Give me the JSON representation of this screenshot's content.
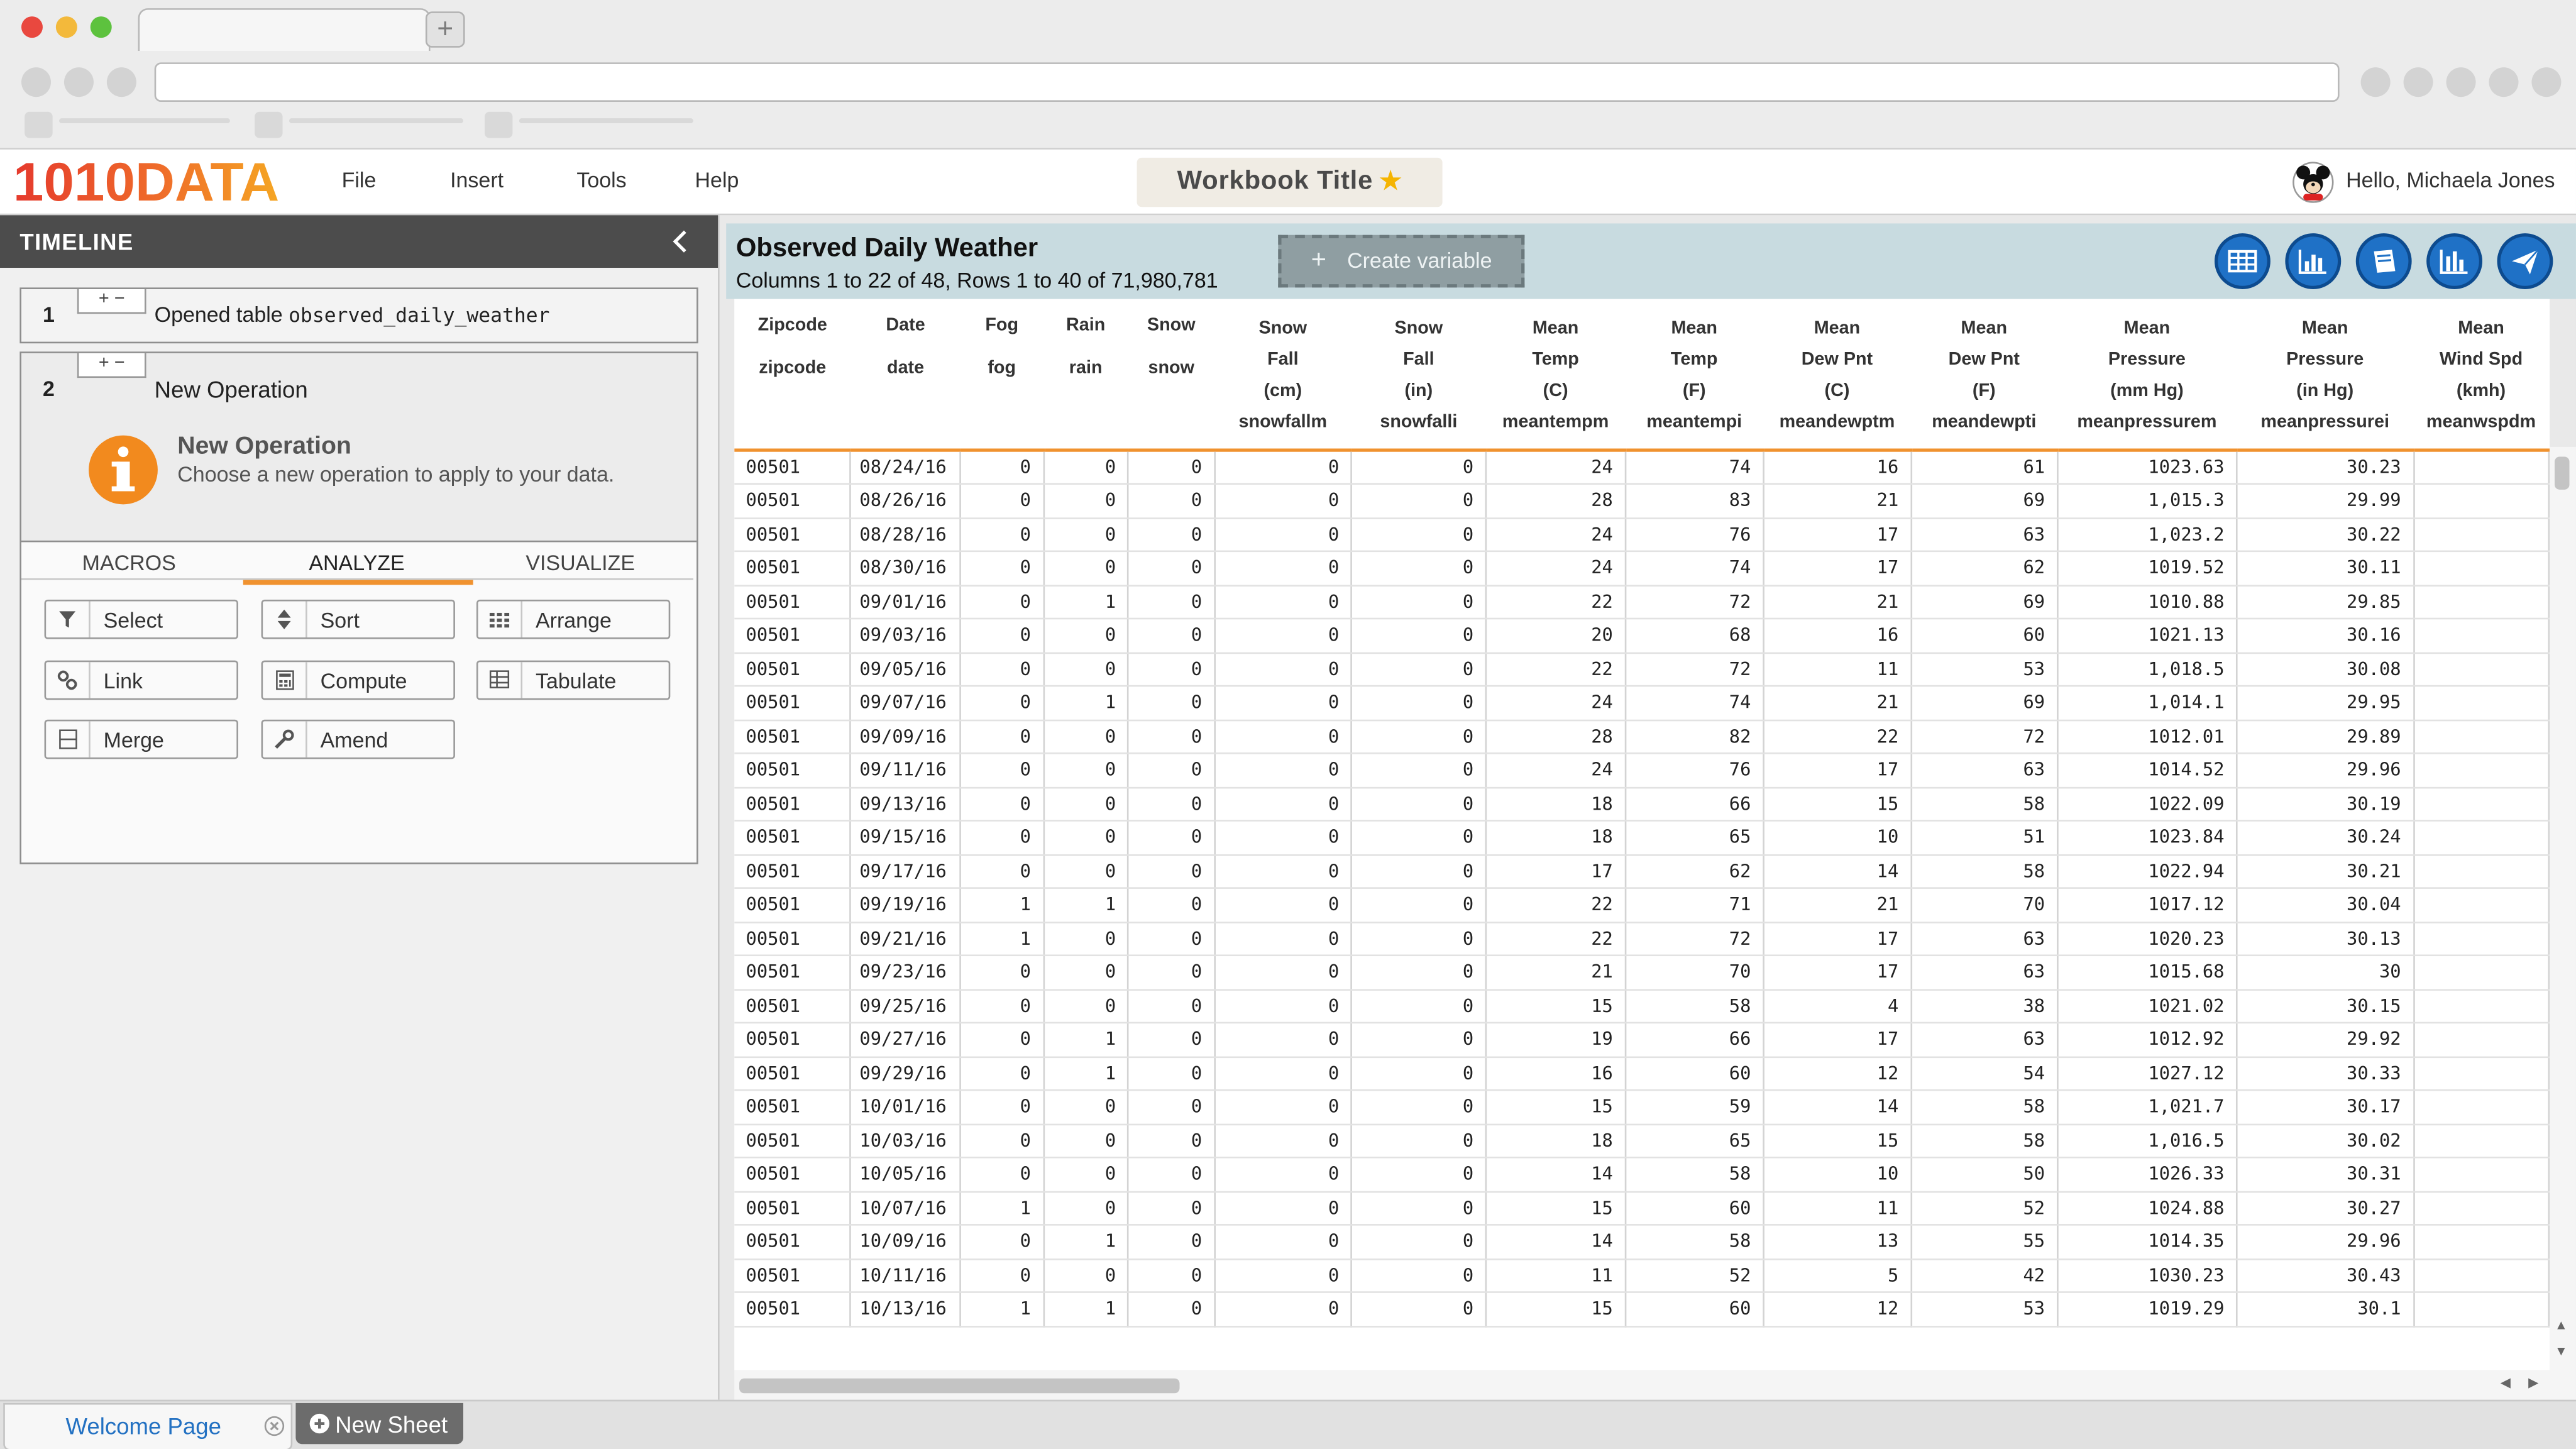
{
  "browser": {
    "traffic_lights": [
      "#e9483f",
      "#f3b93b",
      "#5dc23e"
    ],
    "new_tab_icon": "plus-icon"
  },
  "app": {
    "logo": "1010DATA",
    "logo_colors": [
      "#e53a2d",
      "#f5a623"
    ],
    "menu": [
      "File",
      "Insert",
      "Tools",
      "Help"
    ],
    "workbook_title": "Workbook Title",
    "star_icon": "star-icon",
    "user_greeting": "Hello, Michaela Jones",
    "avatar_icon": "mickey-avatar-icon"
  },
  "sidebar": {
    "title": "TIMELINE",
    "collapse_icon": "chevron-left-icon",
    "steps": [
      {
        "num": "1",
        "label": "Opened table ",
        "table": "observed_daily_weather"
      },
      {
        "num": "2",
        "label": "New Operation"
      }
    ],
    "info": {
      "icon": "info-icon",
      "title": "New Operation",
      "text": "Choose a new operation to apply to your data."
    },
    "tabs": [
      "MACROS",
      "ANALYZE",
      "VISUALIZE"
    ],
    "active_tab": "ANALYZE",
    "operations": [
      {
        "label": "Select",
        "icon": "filter-icon"
      },
      {
        "label": "Sort",
        "icon": "sort-icon"
      },
      {
        "label": "Arrange",
        "icon": "arrange-grid-icon"
      },
      {
        "label": "Link",
        "icon": "link-icon"
      },
      {
        "label": "Compute",
        "icon": "calculator-icon"
      },
      {
        "label": "Tabulate",
        "icon": "table-icon"
      },
      {
        "label": "Merge",
        "icon": "merge-icon"
      },
      {
        "label": "Amend",
        "icon": "wrench-icon"
      }
    ]
  },
  "main": {
    "title": "Observed Daily Weather",
    "subtitle": "Columns 1 to 22 of 48, Rows 1 to 40 of 71,980,781",
    "create_variable": "Create variable",
    "toolbar_icons": [
      "grid-view-icon",
      "bar-chart-icon",
      "book-icon",
      "histogram-icon",
      "send-icon"
    ],
    "accent": "#1f71c6",
    "header_underline": "#f0922f",
    "columns": [
      {
        "lines": [
          "Zipcode",
          "",
          "",
          "zipcode"
        ],
        "align": "l",
        "w": 74
      },
      {
        "lines": [
          "Date",
          "",
          "",
          "date"
        ],
        "align": "c",
        "w": 67
      },
      {
        "lines": [
          "Fog",
          "",
          "",
          "fog"
        ],
        "align": "r",
        "w": 54
      },
      {
        "lines": [
          "Rain",
          "",
          "",
          "rain"
        ],
        "align": "r",
        "w": 55
      },
      {
        "lines": [
          "Snow",
          "",
          "",
          "snow"
        ],
        "align": "r",
        "w": 55
      },
      {
        "lines": [
          "Snow",
          "Fall",
          "(cm)",
          "snowfallm"
        ],
        "align": "r",
        "w": 87
      },
      {
        "lines": [
          "Snow",
          "Fall",
          "(in)",
          "snowfalli"
        ],
        "align": "r",
        "w": 86
      },
      {
        "lines": [
          "Mean",
          "Temp",
          "(C)",
          "meantempm"
        ],
        "align": "r",
        "w": 87
      },
      {
        "lines": [
          "Mean",
          "Temp",
          "(F)",
          "meantempi"
        ],
        "align": "r",
        "w": 87
      },
      {
        "lines": [
          "Mean",
          "Dew Pnt",
          "(C)",
          "meandewptm"
        ],
        "align": "r",
        "w": 92
      },
      {
        "lines": [
          "Mean",
          "Dew Pnt",
          "(F)",
          "meandewpti"
        ],
        "align": "r",
        "w": 92
      },
      {
        "lines": [
          "Mean",
          "Pressure",
          "(mm Hg)",
          "meanpressurem"
        ],
        "align": "r",
        "w": 112
      },
      {
        "lines": [
          "Mean",
          "Pressure",
          "(in Hg)",
          "meanpressurei"
        ],
        "align": "r",
        "w": 111
      },
      {
        "lines": [
          "Mean",
          "Wind Spd",
          "(kmh)",
          "meanwspdm"
        ],
        "align": "r",
        "w": 84
      }
    ],
    "rows": [
      [
        "00501",
        "08/24/16",
        "0",
        "0",
        "0",
        "0",
        "0",
        "24",
        "74",
        "16",
        "61",
        "1023.63",
        "30.23",
        ""
      ],
      [
        "00501",
        "08/26/16",
        "0",
        "0",
        "0",
        "0",
        "0",
        "28",
        "83",
        "21",
        "69",
        "1,015.3",
        "29.99",
        ""
      ],
      [
        "00501",
        "08/28/16",
        "0",
        "0",
        "0",
        "0",
        "0",
        "24",
        "76",
        "17",
        "63",
        "1,023.2",
        "30.22",
        ""
      ],
      [
        "00501",
        "08/30/16",
        "0",
        "0",
        "0",
        "0",
        "0",
        "24",
        "74",
        "17",
        "62",
        "1019.52",
        "30.11",
        ""
      ],
      [
        "00501",
        "09/01/16",
        "0",
        "1",
        "0",
        "0",
        "0",
        "22",
        "72",
        "21",
        "69",
        "1010.88",
        "29.85",
        ""
      ],
      [
        "00501",
        "09/03/16",
        "0",
        "0",
        "0",
        "0",
        "0",
        "20",
        "68",
        "16",
        "60",
        "1021.13",
        "30.16",
        ""
      ],
      [
        "00501",
        "09/05/16",
        "0",
        "0",
        "0",
        "0",
        "0",
        "22",
        "72",
        "11",
        "53",
        "1,018.5",
        "30.08",
        ""
      ],
      [
        "00501",
        "09/07/16",
        "0",
        "1",
        "0",
        "0",
        "0",
        "24",
        "74",
        "21",
        "69",
        "1,014.1",
        "29.95",
        ""
      ],
      [
        "00501",
        "09/09/16",
        "0",
        "0",
        "0",
        "0",
        "0",
        "28",
        "82",
        "22",
        "72",
        "1012.01",
        "29.89",
        ""
      ],
      [
        "00501",
        "09/11/16",
        "0",
        "0",
        "0",
        "0",
        "0",
        "24",
        "76",
        "17",
        "63",
        "1014.52",
        "29.96",
        ""
      ],
      [
        "00501",
        "09/13/16",
        "0",
        "0",
        "0",
        "0",
        "0",
        "18",
        "66",
        "15",
        "58",
        "1022.09",
        "30.19",
        ""
      ],
      [
        "00501",
        "09/15/16",
        "0",
        "0",
        "0",
        "0",
        "0",
        "18",
        "65",
        "10",
        "51",
        "1023.84",
        "30.24",
        ""
      ],
      [
        "00501",
        "09/17/16",
        "0",
        "0",
        "0",
        "0",
        "0",
        "17",
        "62",
        "14",
        "58",
        "1022.94",
        "30.21",
        ""
      ],
      [
        "00501",
        "09/19/16",
        "1",
        "1",
        "0",
        "0",
        "0",
        "22",
        "71",
        "21",
        "70",
        "1017.12",
        "30.04",
        ""
      ],
      [
        "00501",
        "09/21/16",
        "1",
        "0",
        "0",
        "0",
        "0",
        "22",
        "72",
        "17",
        "63",
        "1020.23",
        "30.13",
        ""
      ],
      [
        "00501",
        "09/23/16",
        "0",
        "0",
        "0",
        "0",
        "0",
        "21",
        "70",
        "17",
        "63",
        "1015.68",
        "30",
        ""
      ],
      [
        "00501",
        "09/25/16",
        "0",
        "0",
        "0",
        "0",
        "0",
        "15",
        "58",
        "4",
        "38",
        "1021.02",
        "30.15",
        ""
      ],
      [
        "00501",
        "09/27/16",
        "0",
        "1",
        "0",
        "0",
        "0",
        "19",
        "66",
        "17",
        "63",
        "1012.92",
        "29.92",
        ""
      ],
      [
        "00501",
        "09/29/16",
        "0",
        "1",
        "0",
        "0",
        "0",
        "16",
        "60",
        "12",
        "54",
        "1027.12",
        "30.33",
        ""
      ],
      [
        "00501",
        "10/01/16",
        "0",
        "0",
        "0",
        "0",
        "0",
        "15",
        "59",
        "14",
        "58",
        "1,021.7",
        "30.17",
        ""
      ],
      [
        "00501",
        "10/03/16",
        "0",
        "0",
        "0",
        "0",
        "0",
        "18",
        "65",
        "15",
        "58",
        "1,016.5",
        "30.02",
        ""
      ],
      [
        "00501",
        "10/05/16",
        "0",
        "0",
        "0",
        "0",
        "0",
        "14",
        "58",
        "10",
        "50",
        "1026.33",
        "30.31",
        ""
      ],
      [
        "00501",
        "10/07/16",
        "1",
        "0",
        "0",
        "0",
        "0",
        "15",
        "60",
        "11",
        "52",
        "1024.88",
        "30.27",
        ""
      ],
      [
        "00501",
        "10/09/16",
        "0",
        "1",
        "0",
        "0",
        "0",
        "14",
        "58",
        "13",
        "55",
        "1014.35",
        "29.96",
        ""
      ],
      [
        "00501",
        "10/11/16",
        "0",
        "0",
        "0",
        "0",
        "0",
        "11",
        "52",
        "5",
        "42",
        "1030.23",
        "30.43",
        ""
      ],
      [
        "00501",
        "10/13/16",
        "1",
        "1",
        "0",
        "0",
        "0",
        "15",
        "60",
        "12",
        "53",
        "1019.29",
        "30.1",
        ""
      ]
    ]
  },
  "footer": {
    "tabs": [
      {
        "label": "Welcome Page",
        "close_icon": "close-circle-icon"
      },
      {
        "label": "New Sheet",
        "icon": "plus-circle-icon"
      }
    ]
  }
}
